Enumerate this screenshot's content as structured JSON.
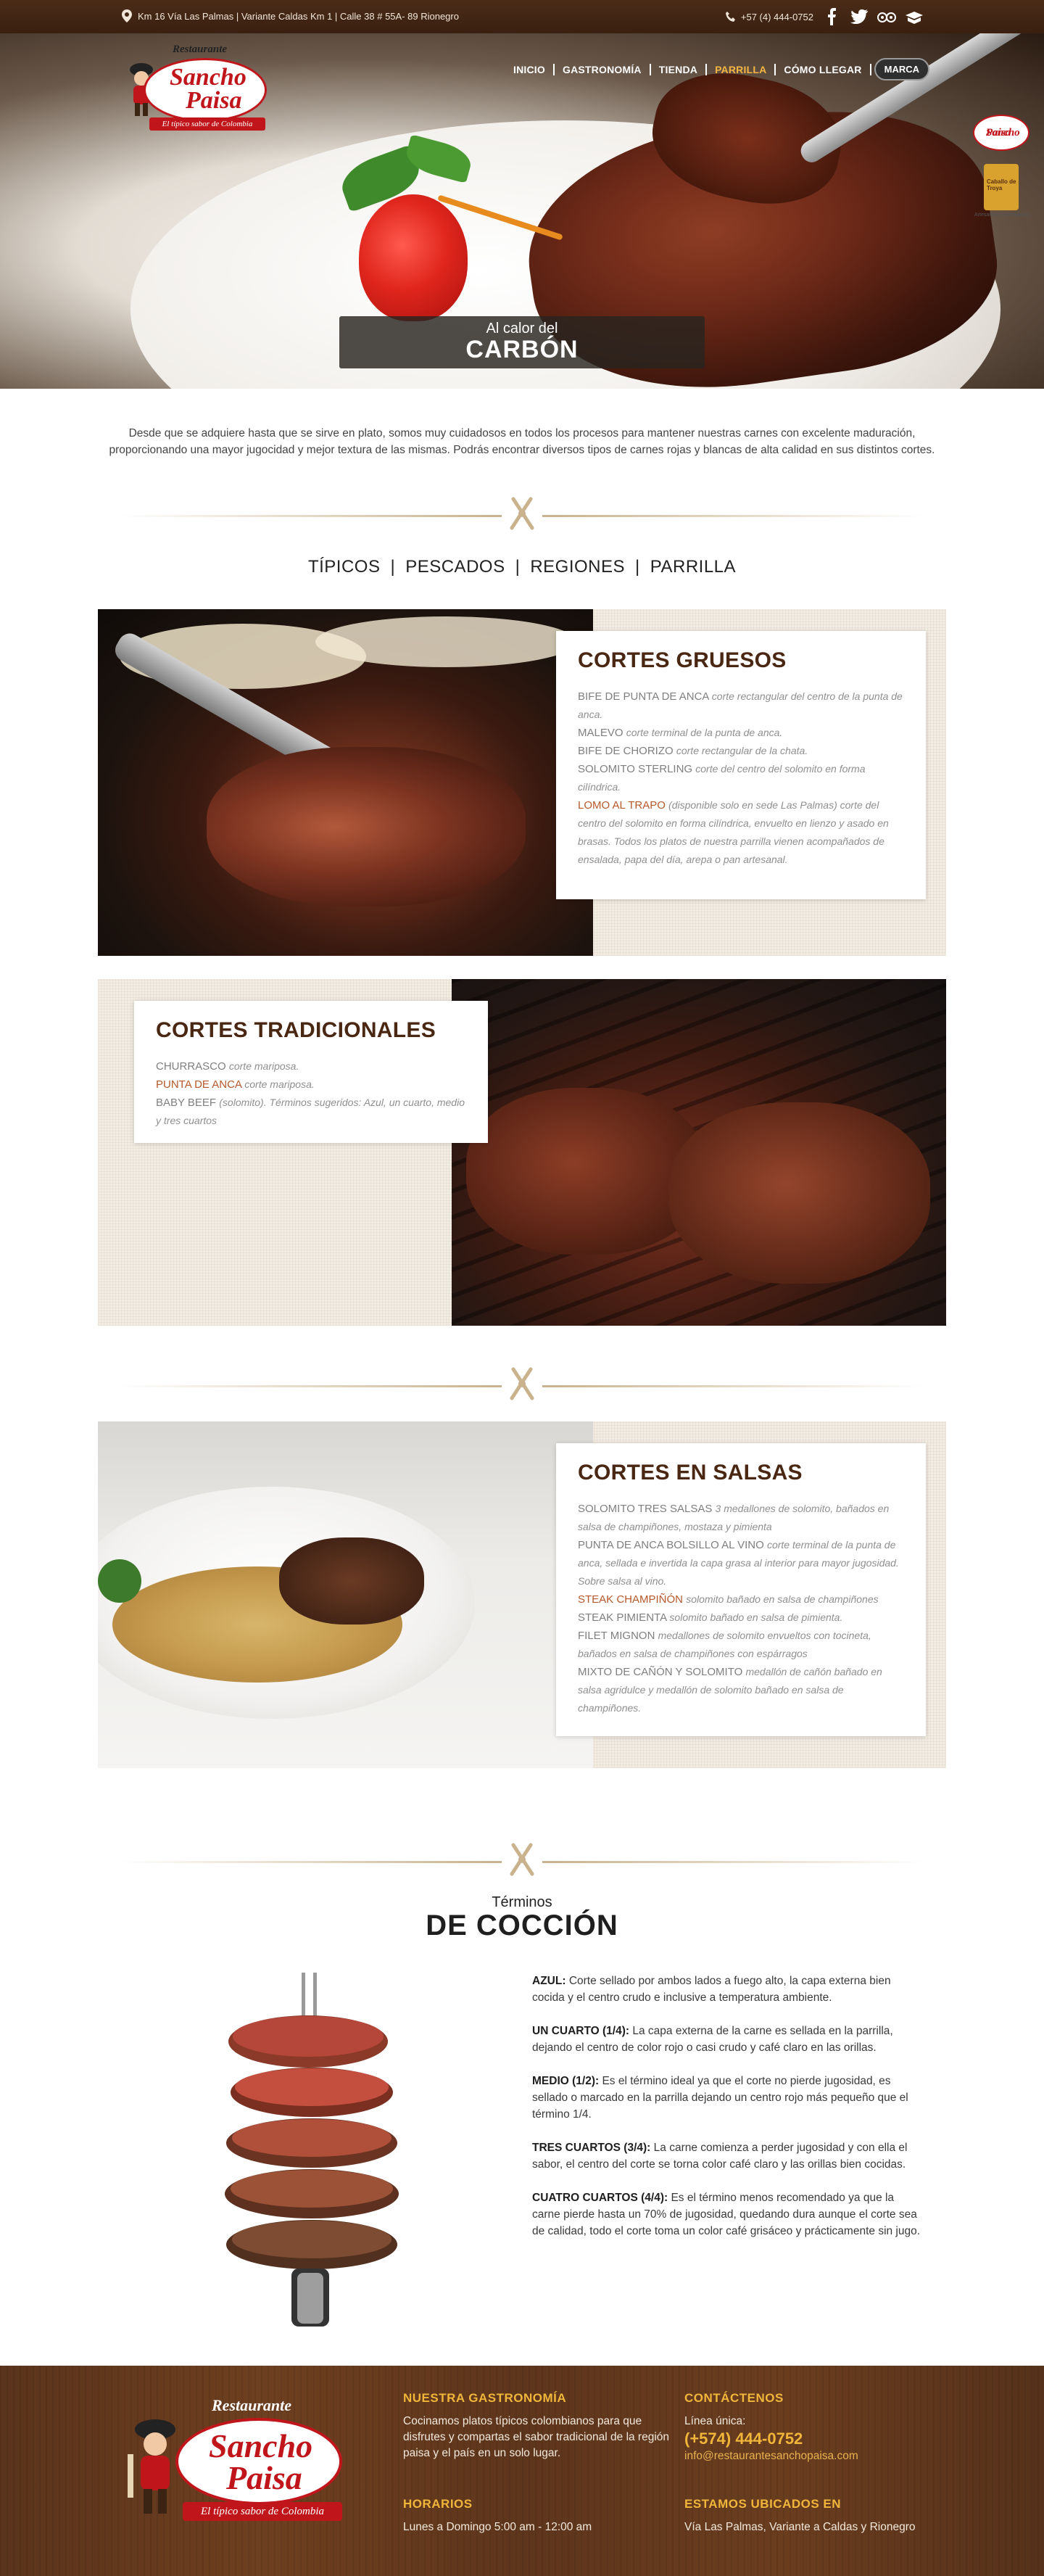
{
  "topbar": {
    "address": "Km 16 Vía Las Palmas | Variante Caldas Km 1 | Calle 38 # 55A- 89 Rionegro",
    "phone": "+57 (4)  444-0752",
    "social": [
      "facebook-icon",
      "twitter-icon",
      "tripadvisor-icon",
      "book-icon"
    ]
  },
  "logo": {
    "top": "Restaurante",
    "name_line1": "Sancho",
    "name_line2": "Paisa",
    "tagline": "El típico sabor de Colombia"
  },
  "nav": {
    "items": [
      "INICIO",
      "GASTRONOMÍA",
      "TIENDA",
      "PARRILLA",
      "CÓMO LLEGAR"
    ],
    "active_index": 3,
    "button": "MARCA"
  },
  "badges": {
    "b1_line1": "Sancho",
    "b1_line2": "Paisa",
    "b2_text": "Caballo de Troya",
    "b2_caption": "Artesanías Colombianas"
  },
  "hero": {
    "line1": "Al calor del",
    "line2": "CARBÓN"
  },
  "intro": "Desde que se adquiere hasta que se sirve en plato, somos muy cuidadosos en todos los procesos para mantener nuestras carnes con excelente maduración, proporcionando una mayor jugocidad y mejor textura de las mismas. Podrás encontrar diversos tipos de carnes rojas y blancas de alta calidad en sus distintos cortes.",
  "tabs": [
    "TÍPICOS",
    "PESCADOS",
    "REGIONES",
    "PARRILLA"
  ],
  "sections": [
    {
      "title": "CORTES GRUESOS",
      "entries": [
        {
          "name": "BIFE DE PUNTA DE ANCA",
          "desc": "corte rectangular del centro de la punta de anca.",
          "highlight": false
        },
        {
          "name": "MALEVO",
          "desc": "corte terminal de la punta de anca.",
          "highlight": false
        },
        {
          "name": "BIFE DE CHORIZO",
          "desc": "corte rectangular de la chata.",
          "highlight": false
        },
        {
          "name": "SOLOMITO STERLING",
          "desc": "corte del centro del solomito en forma cilíndrica.",
          "highlight": false
        },
        {
          "name": "LOMO AL TRAPO",
          "desc": "(disponible solo en sede Las Palmas) corte del centro del solomito en forma cilíndrica, envuelto en lienzo y asado en brasas. Todos los platos de nuestra parrilla vienen acompañados de ensalada, papa del día, arepa o pan artesanal.",
          "highlight": true
        }
      ]
    },
    {
      "title": "CORTES TRADICIONALES",
      "entries": [
        {
          "name": "CHURRASCO",
          "desc": "corte mariposa.",
          "highlight": false
        },
        {
          "name": "PUNTA DE ANCA",
          "desc": "corte mariposa.",
          "highlight": true
        },
        {
          "name": "BABY BEEF",
          "desc": "(solomito). Términos sugeridos: Azul, un cuarto, medio y tres cuartos",
          "highlight": false
        }
      ]
    },
    {
      "title": "CORTES EN SALSAS",
      "entries": [
        {
          "name": "SOLOMITO TRES SALSAS",
          "desc": "3 medallones de solomito, bañados en salsa de champiñones, mostaza y pimienta",
          "highlight": false
        },
        {
          "name": "PUNTA DE ANCA BOLSILLO AL VINO",
          "desc": "corte terminal de la punta de anca, sellada e invertida la capa grasa al interior para mayor jugosidad. Sobre salsa al vino.",
          "highlight": false
        },
        {
          "name": "STEAK CHAMPIÑÓN",
          "desc": "solomito bañado en salsa de champiñones",
          "highlight": true
        },
        {
          "name": "STEAK PIMIENTA",
          "desc": "solomito bañado en salsa de pimienta.",
          "highlight": false
        },
        {
          "name": "FILET MIGNON",
          "desc": "medallones de solomito envueltos con tocineta, bañados en salsa de champiñones con espárragos",
          "highlight": false
        },
        {
          "name": "MIXTO DE CAÑÓN Y SOLOMITO",
          "desc": "medallón de cañón bañado en salsa agridulce y medallón de solomito bañado en salsa de champiñones.",
          "highlight": false
        }
      ]
    }
  ],
  "terminos": {
    "small": "Términos",
    "big": "DE COCCIÓN",
    "items": [
      {
        "label": "AZUL:",
        "text": "Corte sellado por ambos lados a fuego alto, la capa externa bien cocida y el centro crudo e inclusive a temperatura ambiente."
      },
      {
        "label": "UN CUARTO (1/4):",
        "text": "La capa externa de la carne es sellada en la parrilla, dejando el centro de color rojo o casi crudo y café claro en las orillas."
      },
      {
        "label": "MEDIO (1/2):",
        "text": "Es el término ideal ya que el corte no pierde jugosidad, es sellado o marcado en la parrilla dejando un centro rojo más pequeño que el término 1/4."
      },
      {
        "label": "TRES CUARTOS (3/4):",
        "text": "La carne comienza a perder jugosidad y con ella el sabor, el centro del corte se torna color café claro y las orillas bien cocidas."
      },
      {
        "label": "CUATRO CUARTOS (4/4):",
        "text": "Es el término menos recomendado ya que la carne pierde hasta un 70% de jugosidad, quedando dura aunque el corte sea de calidad, todo el corte toma un color café grisáceo y prácticamente sin jugo."
      }
    ]
  },
  "footer": {
    "gastro_title": "NUESTRA GASTRONOMÍA",
    "gastro_text": "Cocinamos platos típicos colombianos para que disfrutes y compartas el sabor tradicional de la región paisa y el país en un solo lugar.",
    "hours_title": "HORARIOS",
    "hours_text": "Lunes a Domingo 5:00 am - 12:00 am",
    "contact_title": "CONTÁCTENOS",
    "contact_label": "Línea única:",
    "contact_phone": "(+574) 444-0752",
    "contact_email": "info@restaurantesanchopaisa.com",
    "location_title": "ESTAMOS UBICADOS EN",
    "location_text": "Vía Las Palmas, Variante a Caldas y Rionegro"
  },
  "colors": {
    "brand_red": "#c0161b",
    "heading_brown": "#4a2713",
    "highlight": "#b5582a",
    "nav_active": "#f6b543",
    "footer_accent": "#f0b63a"
  }
}
